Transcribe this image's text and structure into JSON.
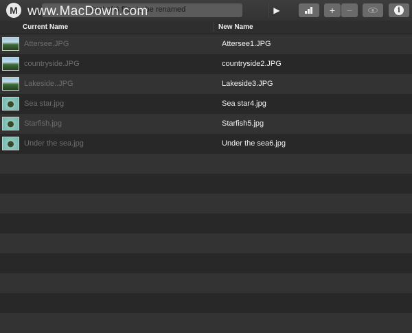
{
  "toolbar": {
    "logo_letter": "M",
    "status_text": "Total of 6 files to be renamed",
    "play_icon": "▶",
    "watermark": "www.MacDown.com",
    "add_label": "+",
    "remove_label": "−",
    "info_label": "i"
  },
  "table": {
    "columns": {
      "current": "Current Name",
      "new": "New Name"
    },
    "rows": [
      {
        "current": "Attersee.JPG",
        "new": "Attersee1.JPG",
        "thumb": "landscape"
      },
      {
        "current": "countryside.JPG",
        "new": "countryside2.JPG",
        "thumb": "landscape"
      },
      {
        "current": "Lakeside..JPG",
        "new": "Lakeside3.JPG",
        "thumb": "landscape"
      },
      {
        "current": "Sea star.jpg",
        "new": "Sea star4.jpg",
        "thumb": "sea"
      },
      {
        "current": "Starfish.jpg",
        "new": "Starfish5.jpg",
        "thumb": "sea"
      },
      {
        "current": "Under the sea.jpg",
        "new": "Under the sea6.jpg",
        "thumb": "sea"
      }
    ]
  },
  "colors": {
    "background": "#2a2a2a",
    "row_even": "#333333",
    "row_odd": "#282828",
    "toolbar_button": "#6a6a6a"
  }
}
